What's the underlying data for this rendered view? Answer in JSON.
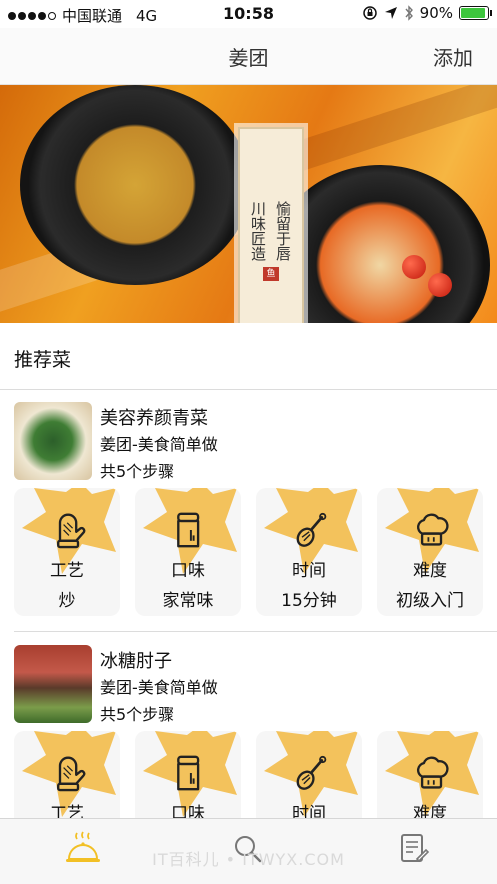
{
  "status_bar": {
    "carrier": "中国联通",
    "network": "4G",
    "time": "10:58",
    "battery": "90%",
    "battery_level": 0.9
  },
  "nav": {
    "title": "姜团",
    "add_label": "添加"
  },
  "banner": {
    "plaque_line1": "川味匠造",
    "plaque_line2": "愉留于唇",
    "seal_text": "鱼",
    "page_count": 4,
    "active_page": 1
  },
  "section": {
    "title": "推荐菜"
  },
  "recipes": [
    {
      "name": "美容养颜青菜",
      "author": "姜团-美食简单做",
      "steps": "共5个步骤",
      "attributes": [
        {
          "label": "工艺",
          "value": "炒",
          "icon": "oven-mitt-icon"
        },
        {
          "label": "口味",
          "value": "家常味",
          "icon": "jar-icon"
        },
        {
          "label": "时间",
          "value": "15分钟",
          "icon": "whisk-icon"
        },
        {
          "label": "难度",
          "value": "初级入门",
          "icon": "chef-hat-icon"
        }
      ]
    },
    {
      "name": "冰糖肘子",
      "author": "姜团-美食简单做",
      "steps": "共5个步骤",
      "attributes": [
        {
          "label": "工艺",
          "icon": "oven-mitt-icon"
        },
        {
          "label": "口味",
          "icon": "jar-icon"
        },
        {
          "label": "时间",
          "icon": "whisk-icon"
        },
        {
          "label": "难度",
          "icon": "chef-hat-icon"
        }
      ]
    }
  ],
  "tabbar": {
    "tabs": [
      {
        "icon": "food-cloche-icon",
        "active": true
      },
      {
        "icon": "search-icon",
        "active": false
      },
      {
        "icon": "notes-icon",
        "active": false
      }
    ]
  },
  "watermark": "IT百科儿 • ITWYX.COM",
  "colors": {
    "accent": "#f3c25c",
    "tab_active": "#f2c025",
    "icon": "#222222"
  }
}
